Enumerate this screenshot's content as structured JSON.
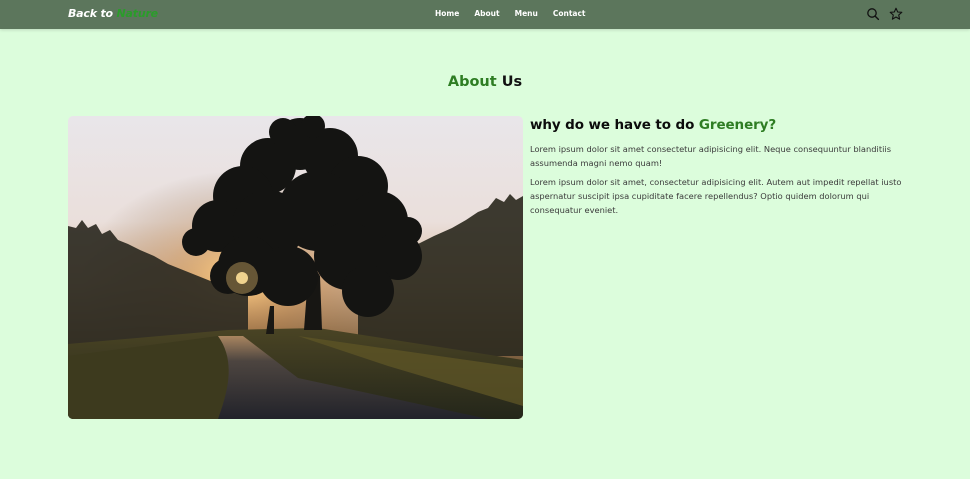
{
  "header": {
    "logo_prefix": "Back to",
    "logo_accent": "Nature",
    "nav": [
      "Home",
      "About",
      "Menu",
      "Contact"
    ],
    "icons": [
      "search-icon",
      "star-icon"
    ]
  },
  "about": {
    "title_accent": "About",
    "title_rest": "Us",
    "subtitle_prefix": "why do we have to do",
    "subtitle_accent": "Greenery?",
    "paragraph1": "Lorem ipsum dolor sit amet consectetur adipisicing elit. Neque consequuntur blanditiis assumenda magni nemo quam!",
    "paragraph2": "Lorem ipsum dolor sit amet, consectetur adipisicing elit. Autem aut impedit repellat iusto aspernatur suscipit ipsa cupiditate facere repellendus? Optio quidem dolorum qui consequatur eveniet."
  },
  "colors": {
    "header_bg": "#5c765c",
    "page_bg": "#dcfddc",
    "accent_green": "#2e7d23",
    "logo_green": "#2a9d2a"
  }
}
